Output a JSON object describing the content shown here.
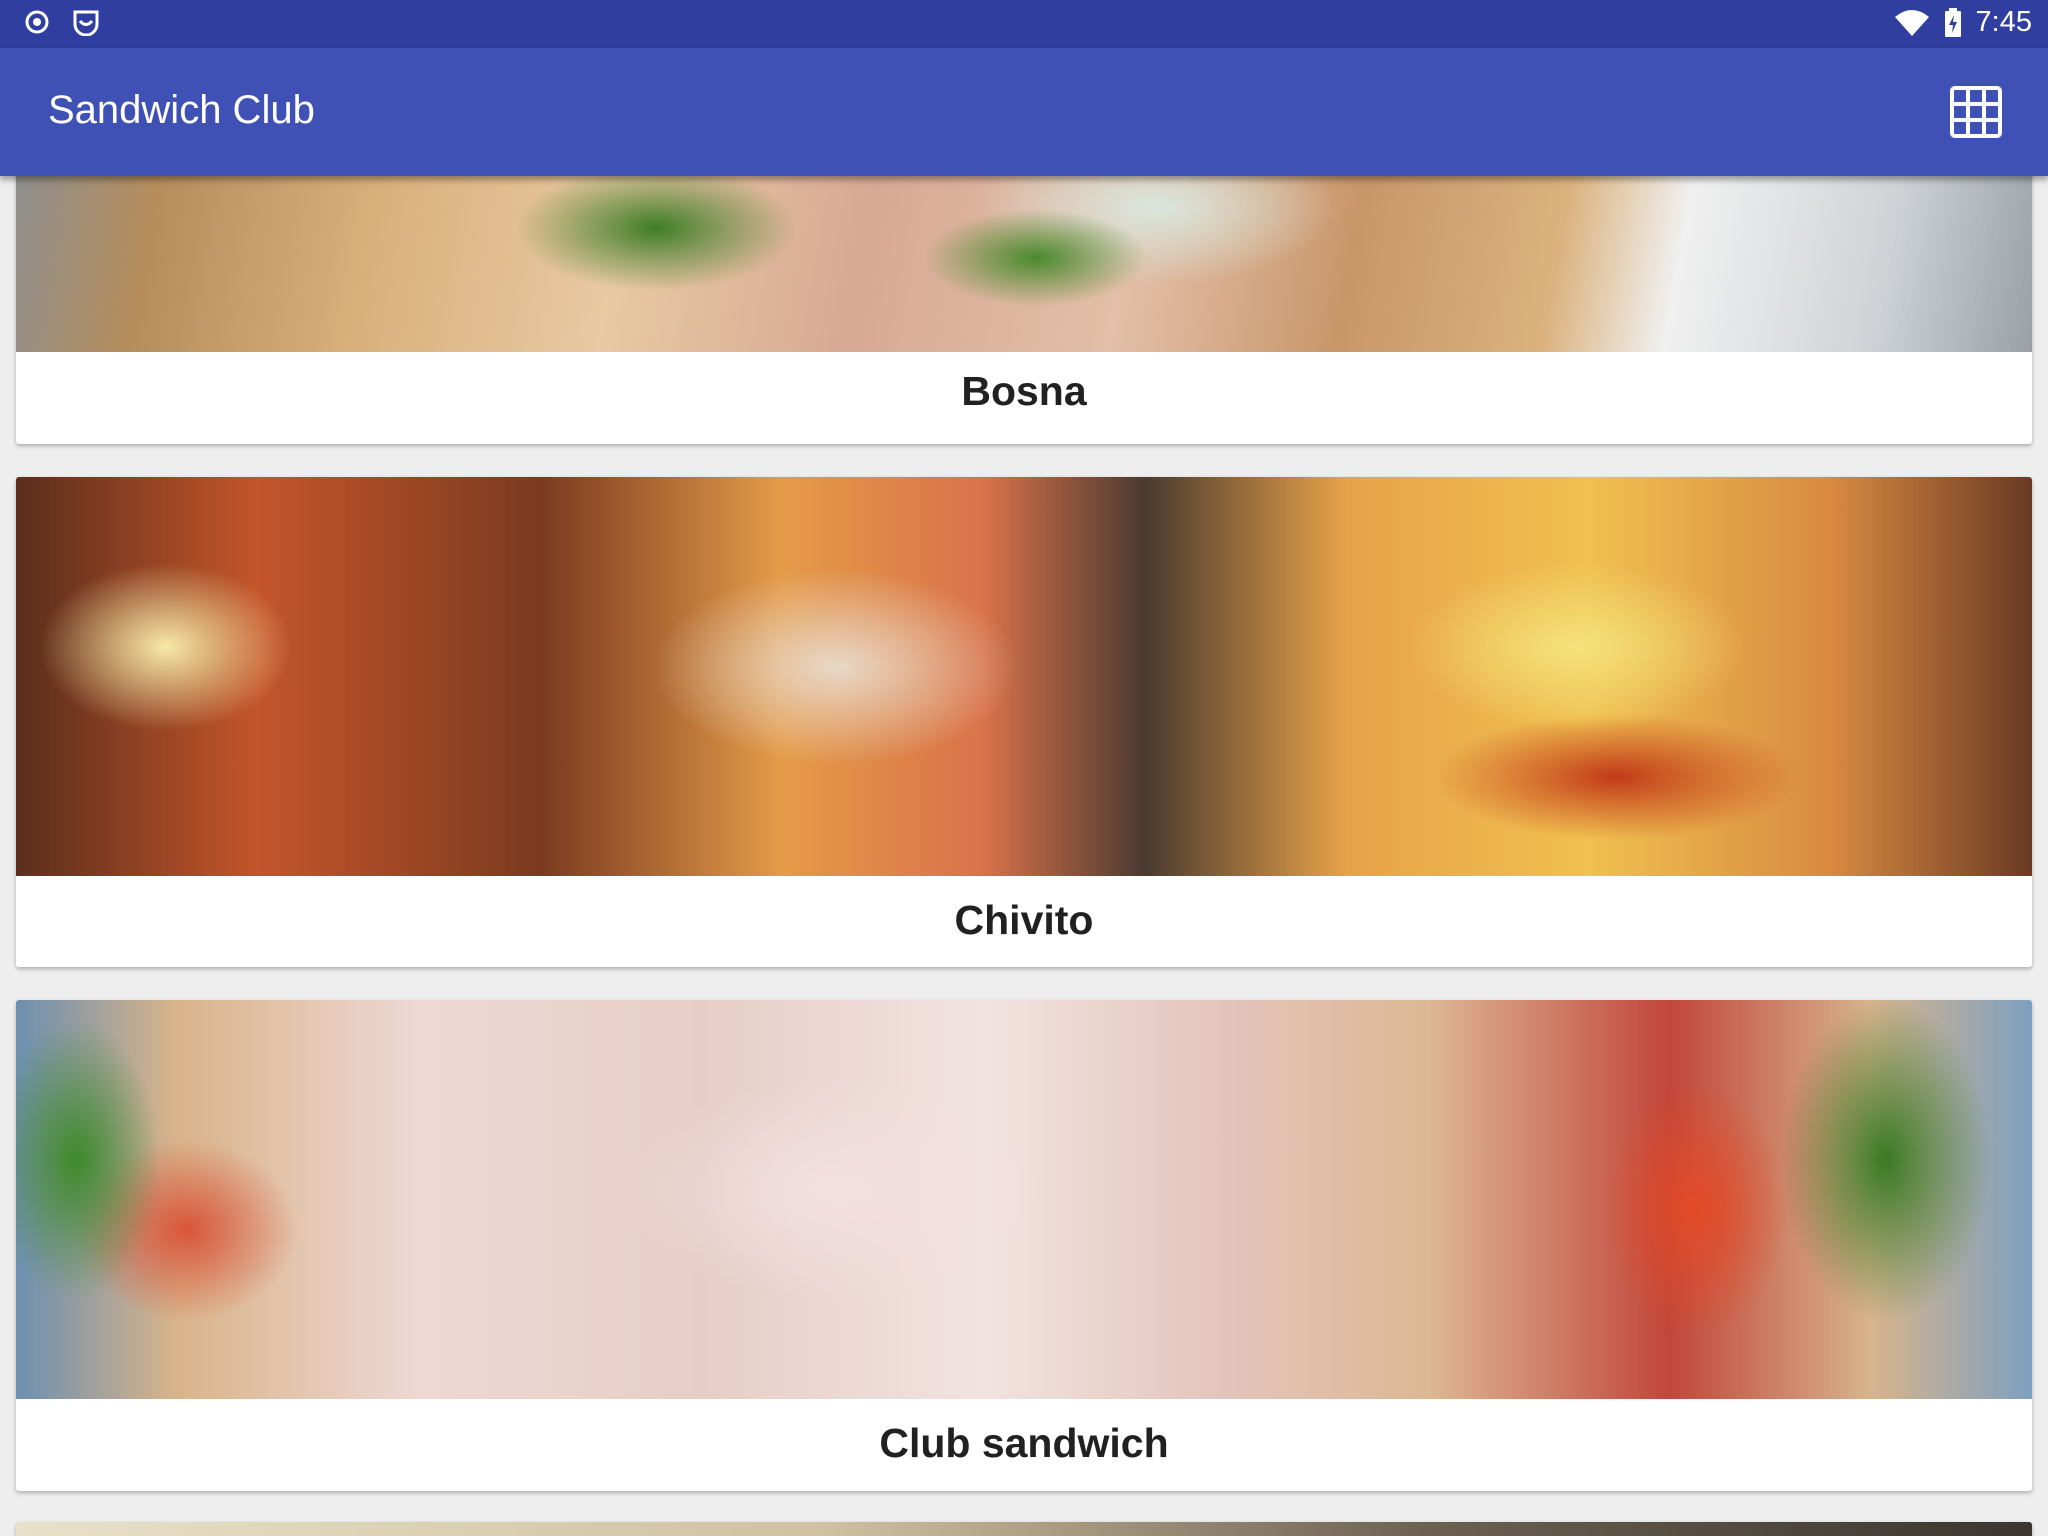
{
  "status_bar": {
    "time": "7:45",
    "left_icons": [
      "circle-dot-icon",
      "smiley-notification-icon"
    ],
    "right_icons": [
      "wifi-icon",
      "battery-charging-icon"
    ]
  },
  "app_bar": {
    "title": "Sandwich Club",
    "action_icon": "grid-view-icon"
  },
  "sandwiches": [
    {
      "name": "Bosna"
    },
    {
      "name": "Chivito"
    },
    {
      "name": "Club sandwich"
    }
  ],
  "colors": {
    "status_bar": "#303f9f",
    "app_bar": "#3f51b5",
    "background": "#eeeeee",
    "card": "#ffffff",
    "text": "#212121"
  }
}
